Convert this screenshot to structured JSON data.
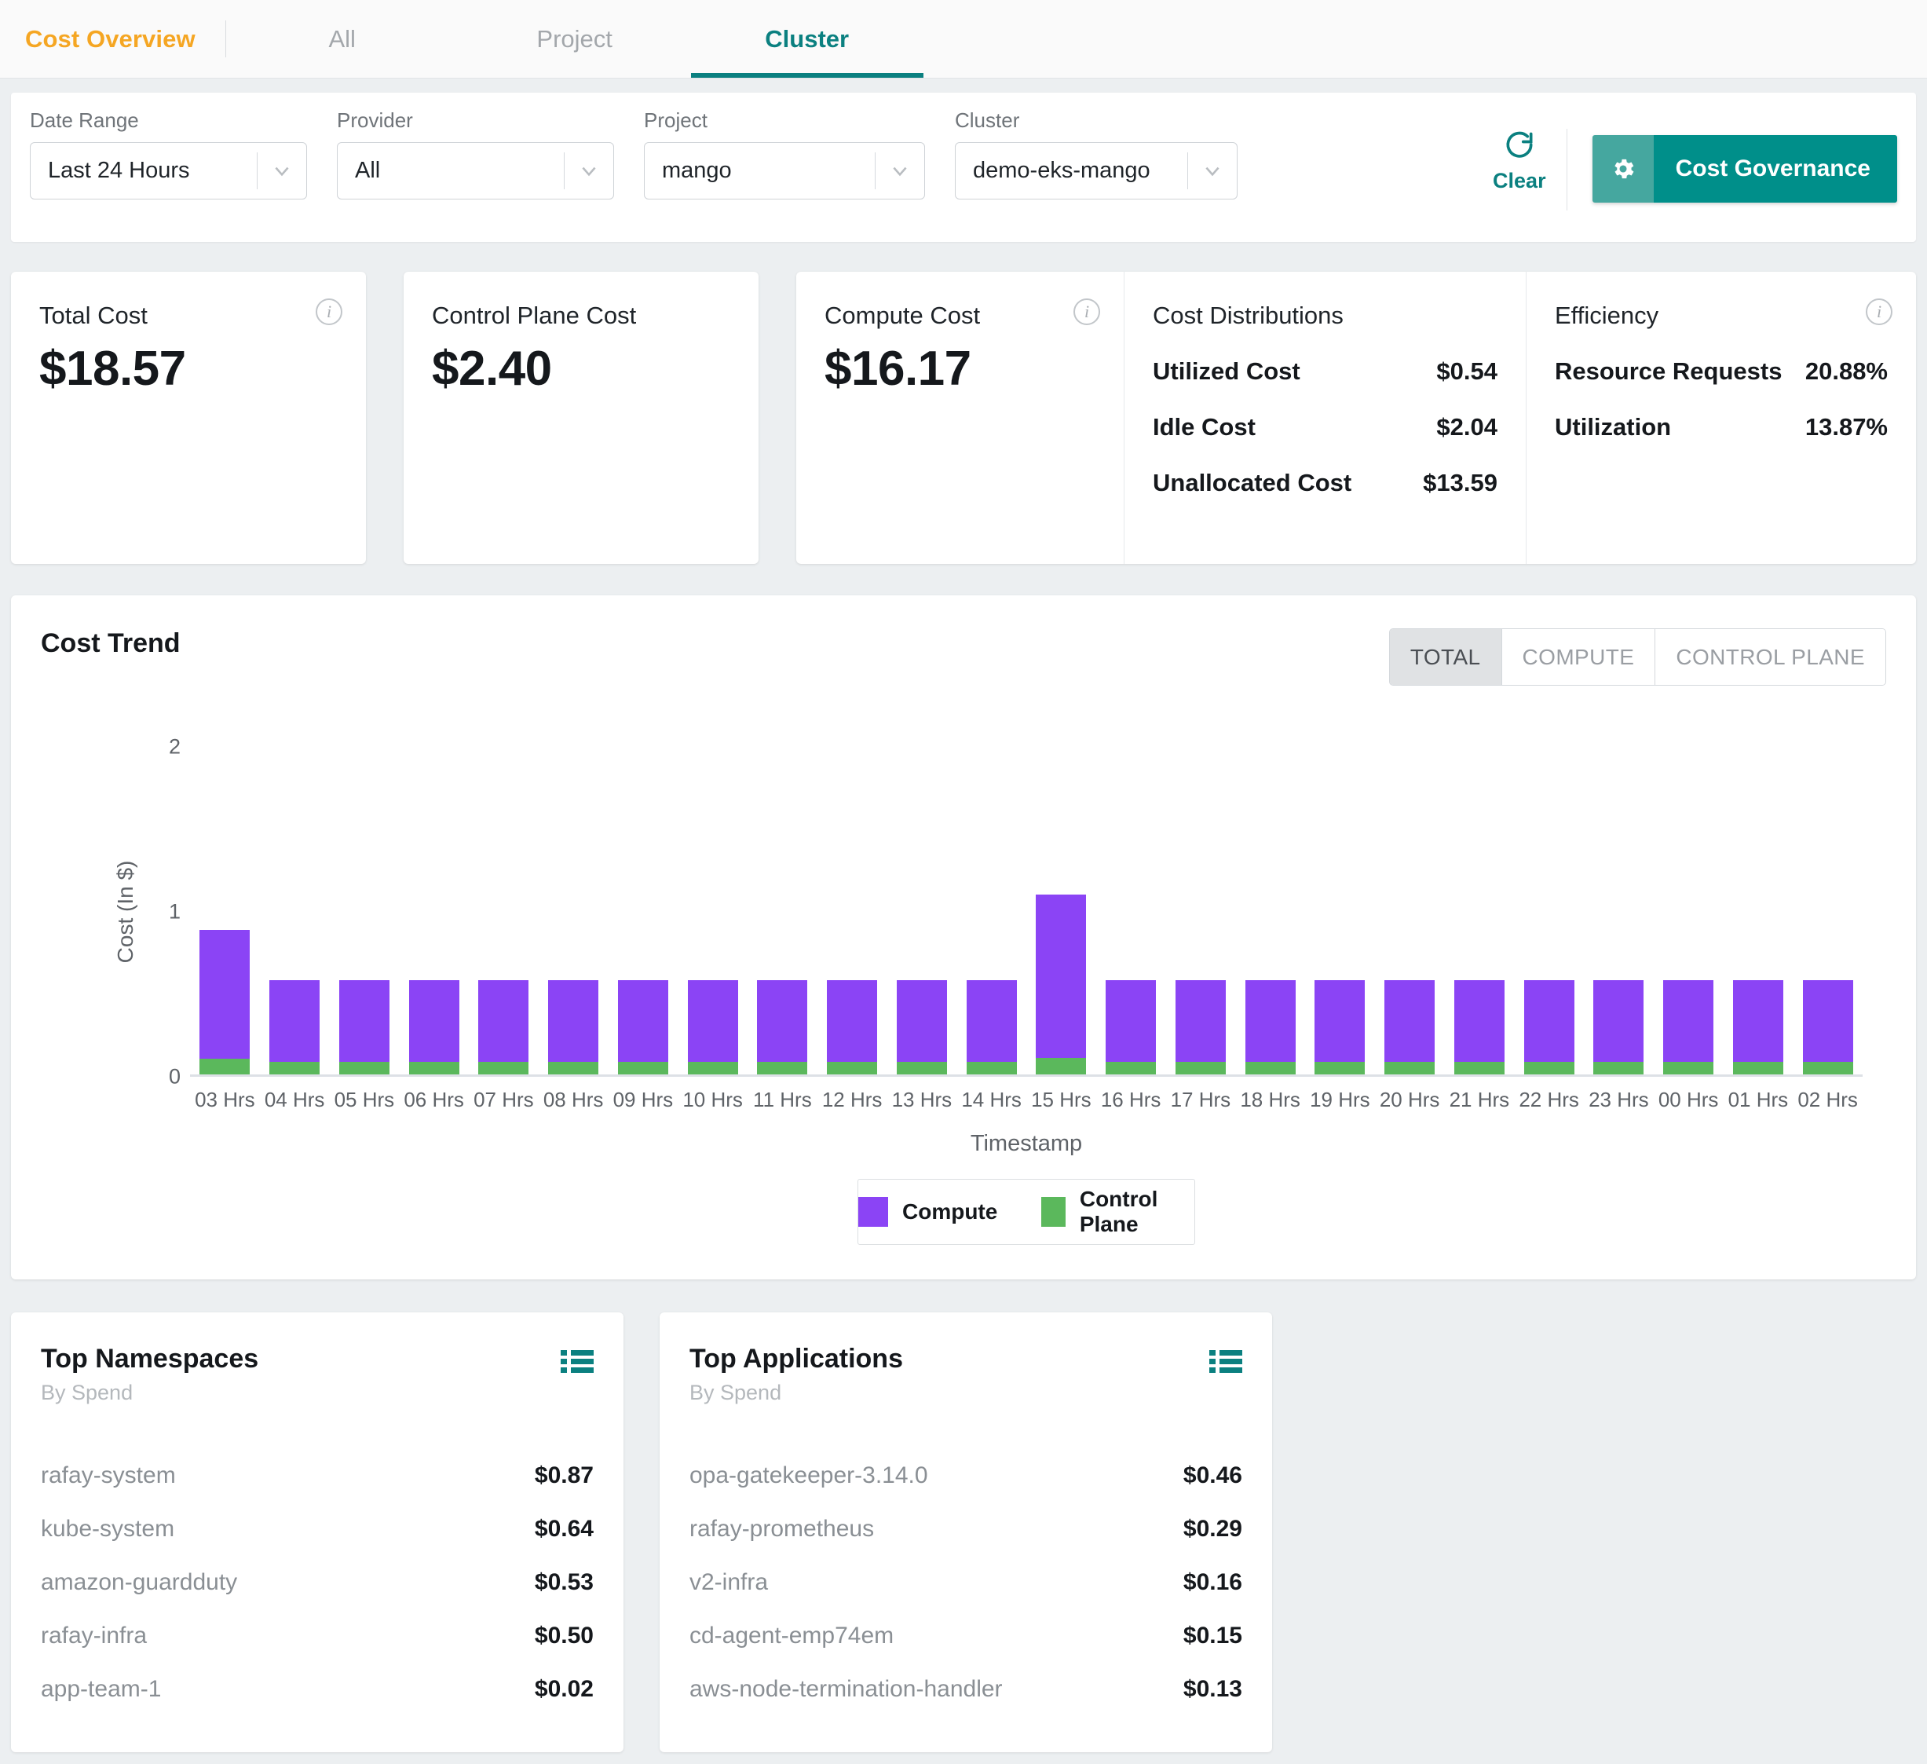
{
  "header": {
    "brand": "Cost Overview",
    "tabs": [
      {
        "label": "All",
        "active": false
      },
      {
        "label": "Project",
        "active": false
      },
      {
        "label": "Cluster",
        "active": true
      }
    ],
    "brand_color": "#f5a623",
    "accent_color": "#0b8080"
  },
  "filters": {
    "date_range": {
      "label": "Date Range",
      "value": "Last 24 Hours"
    },
    "provider": {
      "label": "Provider",
      "value": "All"
    },
    "project": {
      "label": "Project",
      "value": "mango"
    },
    "cluster": {
      "label": "Cluster",
      "value": "demo-eks-mango"
    },
    "clear_label": "Clear",
    "governance_label": "Cost Governance"
  },
  "kpis": {
    "total_cost": {
      "title": "Total Cost",
      "value": "$18.57"
    },
    "control_plane_cost": {
      "title": "Control Plane Cost",
      "value": "$2.40"
    },
    "compute_cost": {
      "title": "Compute Cost",
      "value": "$16.17"
    },
    "cost_distributions": {
      "title": "Cost Distributions",
      "rows": [
        {
          "label": "Utilized Cost",
          "value": "$0.54"
        },
        {
          "label": "Idle Cost",
          "value": "$2.04"
        },
        {
          "label": "Unallocated Cost",
          "value": "$13.59"
        }
      ]
    },
    "efficiency": {
      "title": "Efficiency",
      "rows": [
        {
          "label": "Resource Requests",
          "value": "20.88%"
        },
        {
          "label": "Utilization",
          "value": "13.87%"
        }
      ]
    }
  },
  "cost_trend": {
    "title": "Cost Trend",
    "toggles": [
      {
        "label": "TOTAL",
        "selected": true
      },
      {
        "label": "COMPUTE",
        "selected": false
      },
      {
        "label": "CONTROL PLANE",
        "selected": false
      }
    ]
  },
  "chart_data": {
    "type": "bar",
    "stacked": true,
    "title": "Cost Trend",
    "xlabel": "Timestamp",
    "ylabel": "Cost (In $)",
    "ylim": [
      0,
      2
    ],
    "yticks": [
      0,
      1,
      2
    ],
    "grid": false,
    "legend_position": "bottom",
    "categories": [
      "03 Hrs",
      "04 Hrs",
      "05 Hrs",
      "06 Hrs",
      "07 Hrs",
      "08 Hrs",
      "09 Hrs",
      "10 Hrs",
      "11 Hrs",
      "12 Hrs",
      "13 Hrs",
      "14 Hrs",
      "15 Hrs",
      "16 Hrs",
      "17 Hrs",
      "18 Hrs",
      "19 Hrs",
      "20 Hrs",
      "21 Hrs",
      "22 Hrs",
      "23 Hrs",
      "00 Hrs",
      "01 Hrs",
      "02 Hrs"
    ],
    "series": [
      {
        "name": "Compute",
        "color": "#8b44f5",
        "values": [
          0.84,
          0.66,
          0.66,
          0.66,
          0.66,
          0.66,
          0.66,
          0.66,
          0.66,
          0.66,
          0.66,
          0.66,
          1.0,
          0.66,
          0.66,
          0.66,
          0.66,
          0.66,
          0.66,
          0.66,
          0.66,
          0.66,
          0.66,
          0.66
        ]
      },
      {
        "name": "Control Plane",
        "color": "#5bb85c",
        "values": [
          0.1,
          0.1,
          0.1,
          0.1,
          0.1,
          0.1,
          0.1,
          0.1,
          0.1,
          0.1,
          0.1,
          0.1,
          0.1,
          0.1,
          0.1,
          0.1,
          0.1,
          0.1,
          0.1,
          0.1,
          0.1,
          0.1,
          0.1,
          0.1
        ]
      }
    ]
  },
  "top_namespaces": {
    "title": "Top Namespaces",
    "subtitle": "By Spend",
    "rows": [
      {
        "name": "rafay-system",
        "value": "$0.87"
      },
      {
        "name": "kube-system",
        "value": "$0.64"
      },
      {
        "name": "amazon-guardduty",
        "value": "$0.53"
      },
      {
        "name": "rafay-infra",
        "value": "$0.50"
      },
      {
        "name": "app-team-1",
        "value": "$0.02"
      }
    ]
  },
  "top_applications": {
    "title": "Top Applications",
    "subtitle": "By Spend",
    "rows": [
      {
        "name": "opa-gatekeeper-3.14.0",
        "value": "$0.46"
      },
      {
        "name": "rafay-prometheus",
        "value": "$0.29"
      },
      {
        "name": "v2-infra",
        "value": "$0.16"
      },
      {
        "name": "cd-agent-emp74em",
        "value": "$0.15"
      },
      {
        "name": "aws-node-termination-handler",
        "value": "$0.13"
      }
    ]
  }
}
